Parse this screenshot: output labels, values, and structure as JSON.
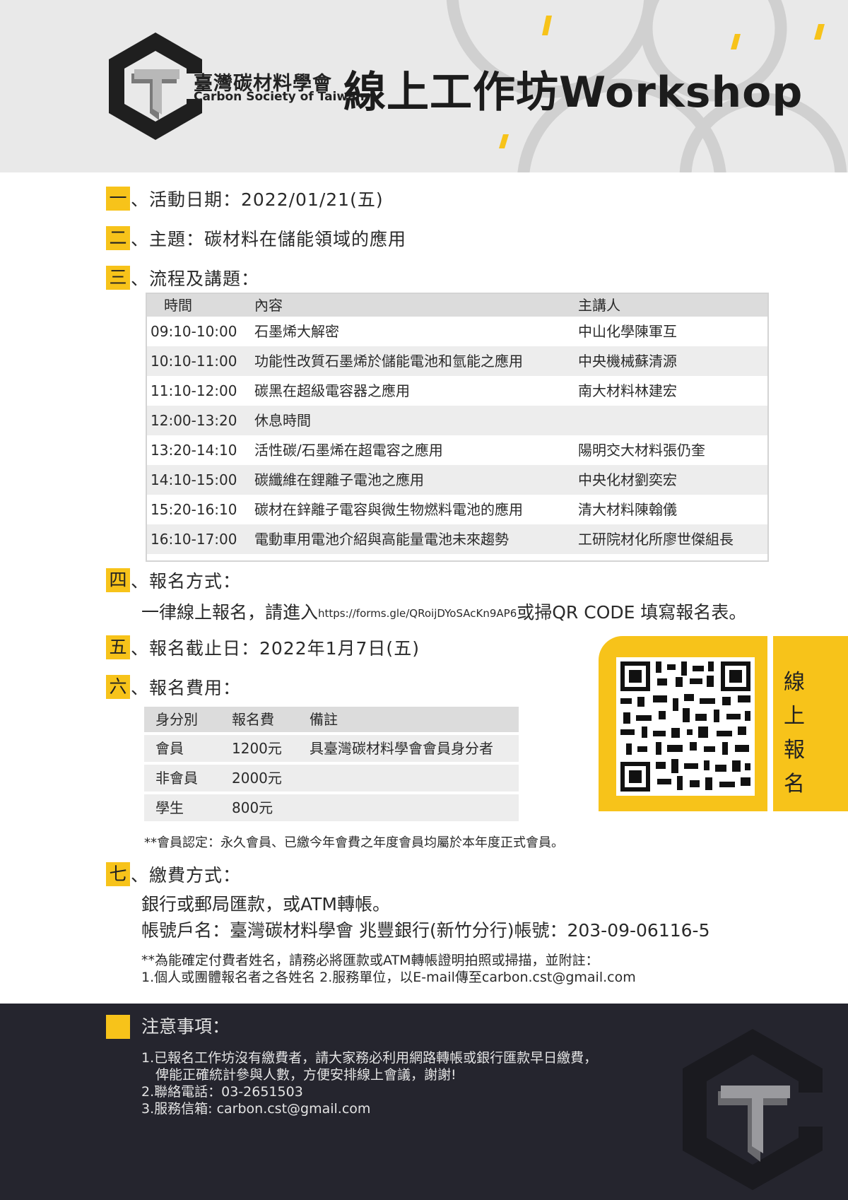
{
  "header": {
    "org_name_zh": "臺灣碳材料學會",
    "org_name_en": "Carbon Society of Taiwan",
    "title": "線上工作坊Workshop",
    "accent_color": "#f7c31a"
  },
  "sections": {
    "s1": {
      "num": "一",
      "text": "、活動日期：2022/01/21(五)"
    },
    "s2": {
      "num": "二",
      "text": "、主題：碳材料在儲能領域的應用"
    },
    "s3": {
      "num": "三",
      "text": "、流程及講題："
    },
    "s4": {
      "num": "四",
      "text": "、報名方式：",
      "line_prefix": "一律線上報名，請進入",
      "url": "https://forms.gle/QRoijDYoSAcKn9AP6",
      "line_suffix": "或掃QR CODE 填寫報名表。"
    },
    "s5": {
      "num": "五",
      "text": "、報名截止日：2022年1月7日(五)"
    },
    "s6": {
      "num": "六",
      "text": "、報名費用："
    },
    "s7": {
      "num": "七",
      "text": "、繳費方式：",
      "line1": "銀行或郵局匯款，或ATM轉帳。",
      "line2": "帳號戶名：臺灣碳材料學會 兆豐銀行(新竹分行)帳號：203-09-06116-5",
      "note1": "**為能確定付費者姓名，請務必將匯款或ATM轉帳證明拍照或掃描，並附註：",
      "note2": "1.個人或團體報名者之各姓名  2.服務單位，以E-mail傳至carbon.cst@gmail.com"
    }
  },
  "schedule": {
    "headers": [
      "時間",
      "內容",
      "主講人"
    ],
    "rows": [
      {
        "time": "09:10-10:00",
        "content": "石墨烯大解密",
        "speaker": "中山化學陳軍互"
      },
      {
        "time": "10:10-11:00",
        "content": "功能性改質石墨烯於儲能電池和氫能之應用",
        "speaker": "中央機械蘇清源"
      },
      {
        "time": "11:10-12:00",
        "content": "碳黑在超級電容器之應用",
        "speaker": "南大材料林建宏"
      },
      {
        "time": "12:00-13:20",
        "content": "休息時間",
        "speaker": ""
      },
      {
        "time": "13:20-14:10",
        "content": "活性碳/石墨烯在超電容之應用",
        "speaker": "陽明交大材料張仍奎"
      },
      {
        "time": "14:10-15:00",
        "content": "碳纖維在鋰離子電池之應用",
        "speaker": "中央化材劉奕宏"
      },
      {
        "time": "15:20-16:10",
        "content": "碳材在鋅離子電容與微生物燃料電池的應用",
        "speaker": "清大材料陳翰儀"
      },
      {
        "time": "16:10-17:00",
        "content": "電動車用電池介紹與高能量電池未來趨勢",
        "speaker": "工研院材化所廖世傑組長"
      }
    ]
  },
  "fees": {
    "headers": [
      "身分別",
      "報名費",
      "備註"
    ],
    "rows": [
      {
        "type": "會員",
        "fee": "1200元",
        "note": "具臺灣碳材料學會會員身分者"
      },
      {
        "type": "非會員",
        "fee": "2000元",
        "note": ""
      },
      {
        "type": "學生",
        "fee": "800元",
        "note": ""
      }
    ],
    "footnote": "**會員認定：永久會員、已繳今年會費之年度會員均屬於本年度正式會員。"
  },
  "registration_panel": {
    "chars": [
      "線",
      "上",
      "報",
      "名"
    ]
  },
  "footer": {
    "title": "注意事項：",
    "item1_line1": "1.已報名工作坊沒有繳費者，請大家務必利用網路轉帳或銀行匯款早日繳費，",
    "item1_line2": "俾能正確統計參與人數，方便安排線上會議，謝謝!",
    "item2": "2.聯絡電話：03-2651503",
    "item3": "3.服務信箱: carbon.cst@gmail.com"
  }
}
